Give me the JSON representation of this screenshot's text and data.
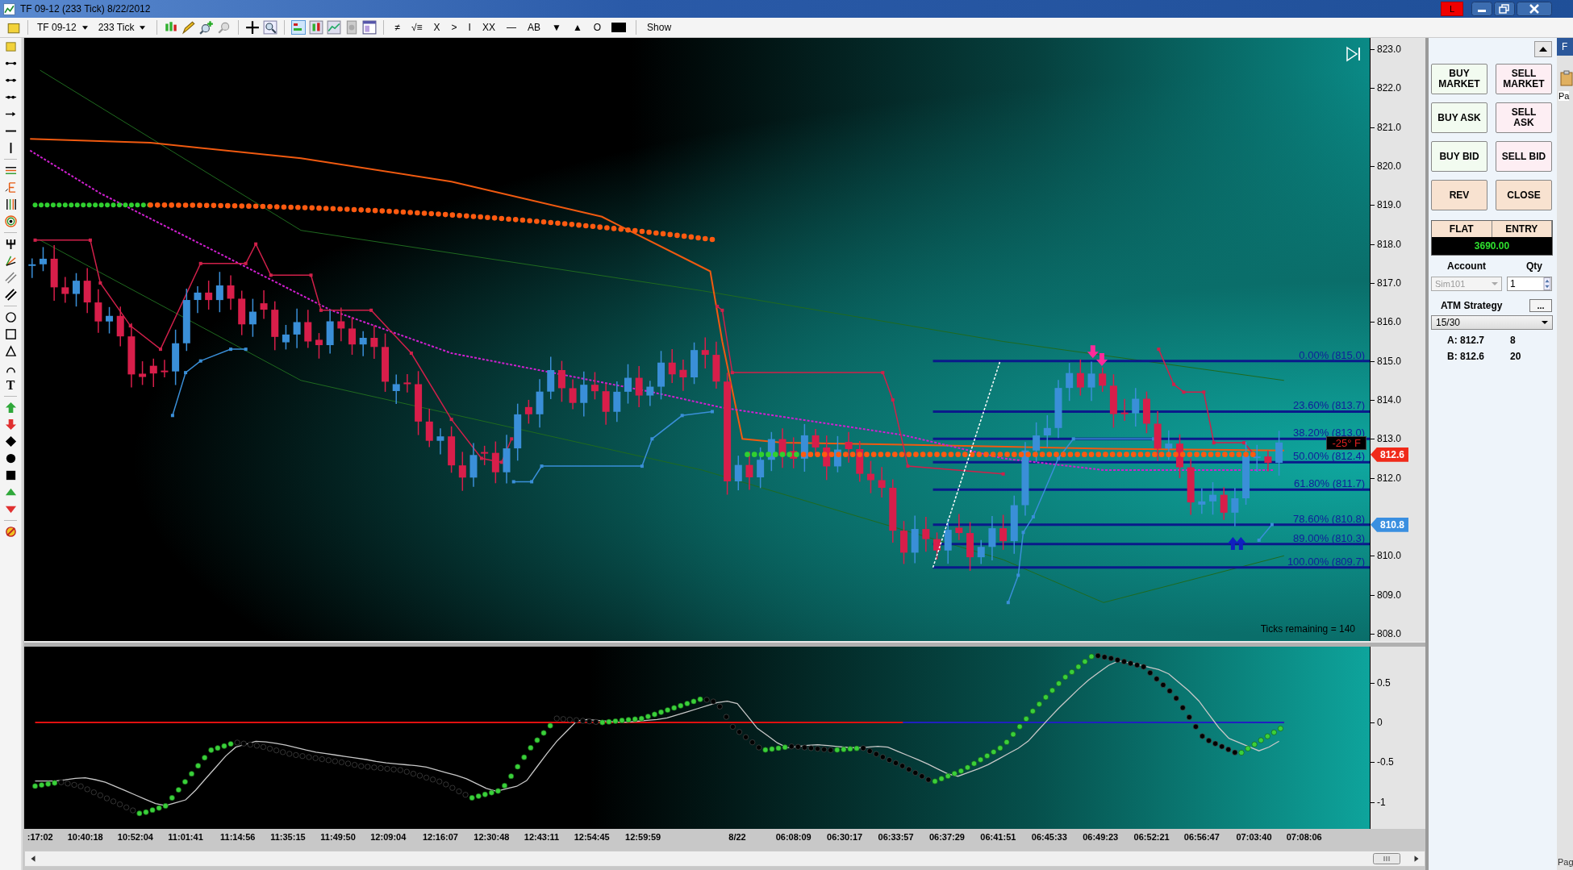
{
  "window": {
    "title": "TF 09-12 (233 Tick)  8/22/2012",
    "badge": "L"
  },
  "toolbar": {
    "instrument": "TF 09-12",
    "interval": "233 Tick",
    "text_tools": [
      "≠",
      "√≡",
      "X",
      ">",
      "I",
      "XX",
      "—",
      "AB",
      "▼",
      "▲",
      "O"
    ],
    "show": "Show"
  },
  "drawing_tools": {
    "text_tool": "T"
  },
  "price_pane": {
    "axis_labels": [
      "823.0",
      "822.0",
      "821.0",
      "820.0",
      "819.0",
      "818.0",
      "817.0",
      "816.0",
      "815.0",
      "814.0",
      "813.0",
      "812.0",
      "810.0",
      "809.0",
      "808.0"
    ],
    "fib_levels": [
      "0.00% (815.0)",
      "23.60% (813.7)",
      "38.20% (813.0)",
      "50.00% (812.4)",
      "61.80% (811.7)",
      "78.60% (810.8)",
      "89.00% (810.3)",
      "100.00% (809.7)"
    ],
    "temperature": "-25° F",
    "last_price": "812.6",
    "marker_price": "810.8",
    "ticks_remaining": "Ticks remaining = 140"
  },
  "oscillator_pane": {
    "axis_labels": [
      "0.5",
      "0",
      "-0.5",
      "-1"
    ]
  },
  "time_axis": {
    "labels": [
      ":17:02",
      "10:40:18",
      "10:52:04",
      "11:01:41",
      "11:14:56",
      "11:35:15",
      "11:49:50",
      "12:09:04",
      "12:16:07",
      "12:30:48",
      "12:43:11",
      "12:54:45",
      "12:59:59",
      "8/22",
      "06:08:09",
      "06:30:17",
      "06:33:57",
      "06:37:29",
      "06:41:51",
      "06:45:33",
      "06:49:23",
      "06:52:21",
      "06:56:47",
      "07:03:40",
      "07:08:06"
    ]
  },
  "order_panel": {
    "buttons": [
      {
        "label": "BUY\nMARKET",
        "kind": "buy"
      },
      {
        "label": "SELL\nMARKET",
        "kind": "sell"
      },
      {
        "label": "BUY ASK",
        "kind": "buy"
      },
      {
        "label": "SELL\nASK",
        "kind": "sell"
      },
      {
        "label": "BUY BID",
        "kind": "buy"
      },
      {
        "label": "SELL BID",
        "kind": "sell"
      },
      {
        "label": "REV",
        "kind": "neutral"
      },
      {
        "label": "CLOSE",
        "kind": "neutral"
      }
    ],
    "position": "FLAT",
    "entry": "ENTRY",
    "pnl": "3690.00",
    "account": {
      "label": "Account",
      "value": "Sim101",
      "disabled": true
    },
    "qty": {
      "label": "Qty",
      "value": "1"
    },
    "atm": {
      "label": "ATM Strategy",
      "more": "...",
      "value": "15/30"
    },
    "quotes": [
      {
        "label": "A: 812.7",
        "size": "8"
      },
      {
        "label": "B: 812.6",
        "size": "20"
      }
    ]
  },
  "side_window": {
    "tab": "F",
    "label": "Pa",
    "footer": "Pag"
  }
}
